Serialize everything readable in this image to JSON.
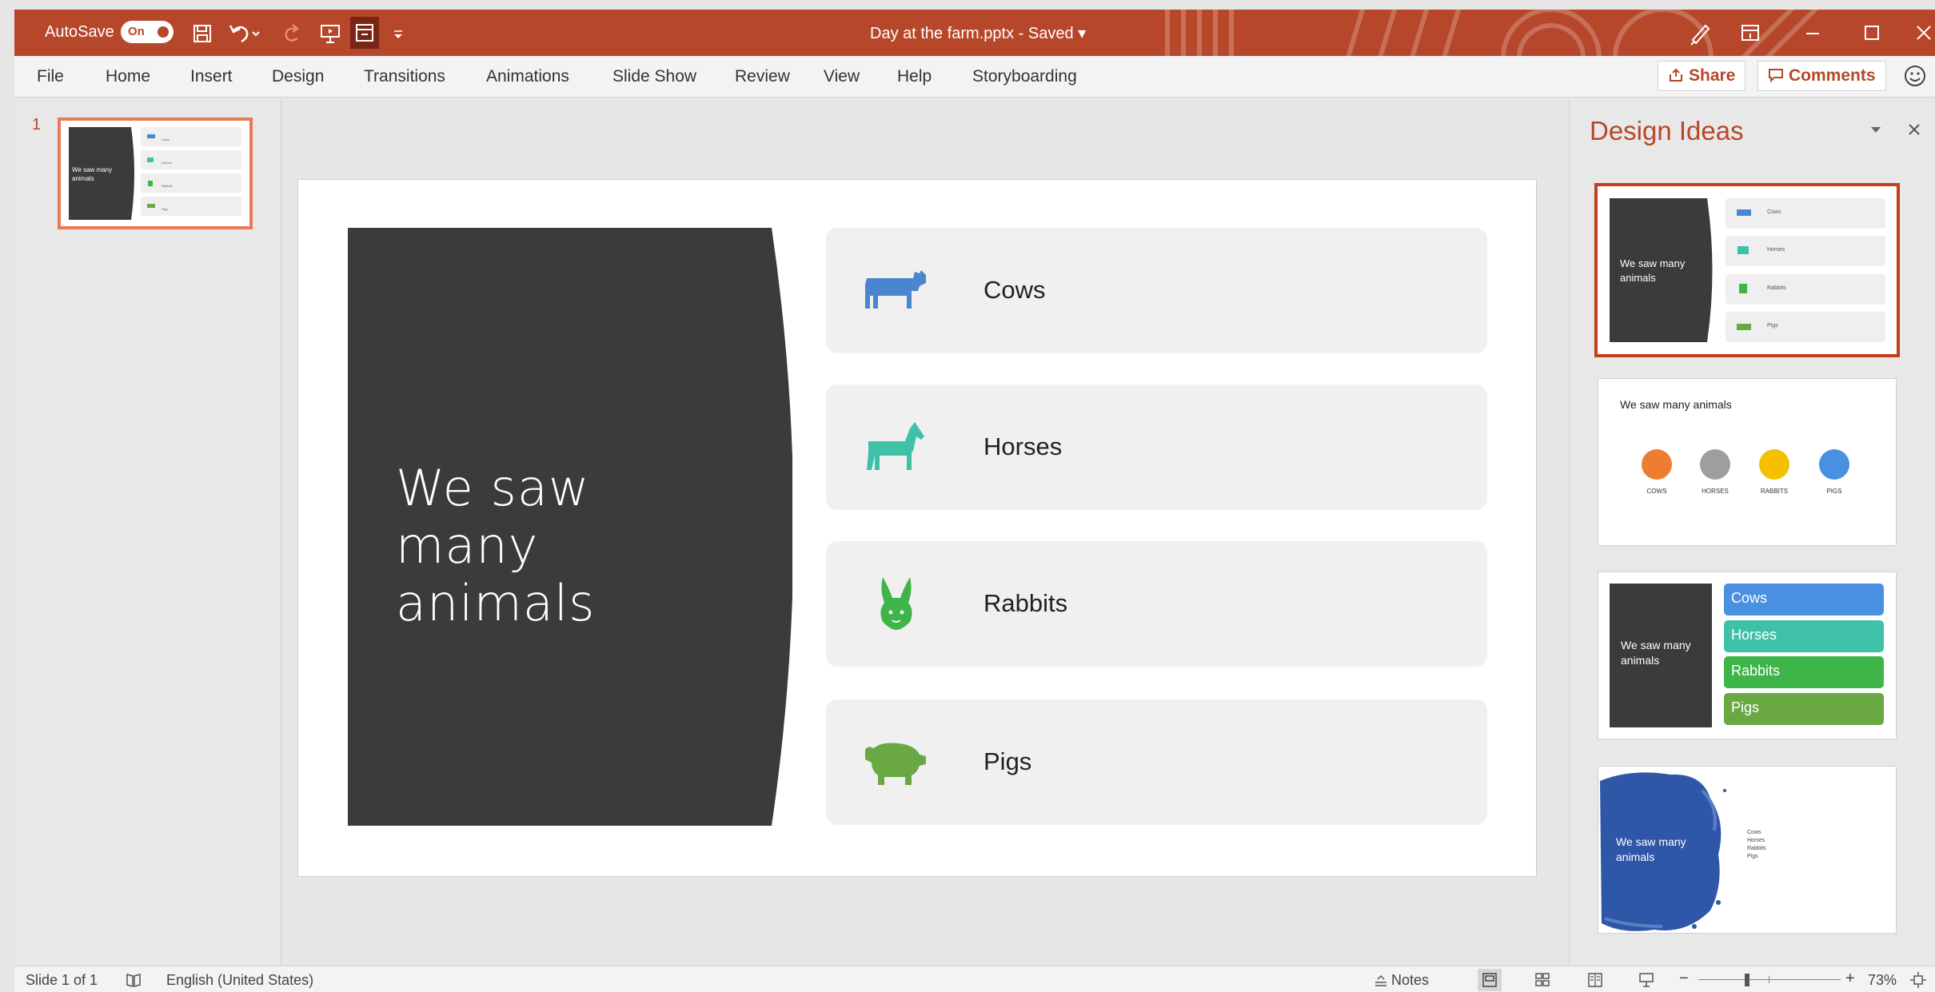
{
  "titlebar": {
    "autosave_label": "AutoSave",
    "autosave_state": "On",
    "doc_title": "Day at the farm.pptx  -  Saved  ▾",
    "accent": "#b7472a"
  },
  "tabs": [
    "File",
    "Home",
    "Insert",
    "Design",
    "Transitions",
    "Animations",
    "Slide Show",
    "Review",
    "View",
    "Help",
    "Storyboarding"
  ],
  "share_label": "Share",
  "comments_label": "Comments",
  "thumbnail": {
    "number": "1",
    "title": "We saw many animals",
    "items": [
      "Cows",
      "Horses",
      "Rabbits",
      "Pigs"
    ]
  },
  "slide": {
    "title": "We saw many animals",
    "items": [
      {
        "label": "Cows",
        "icon": "cow-icon",
        "color": "#4a86d0"
      },
      {
        "label": "Horses",
        "icon": "horse-icon",
        "color": "#3fc1a8"
      },
      {
        "label": "Rabbits",
        "icon": "rabbit-icon",
        "color": "#3db548"
      },
      {
        "label": "Pigs",
        "icon": "pig-icon",
        "color": "#6aa843"
      }
    ]
  },
  "design_ideas": {
    "title": "Design Ideas",
    "idea1": {
      "title": "We saw many animals",
      "items": [
        "Cows",
        "Horses",
        "Rabbits",
        "Pigs"
      ]
    },
    "idea2": {
      "title": "We saw many animals",
      "items": [
        "COWS",
        "HORSES",
        "RABBITS",
        "PIGS"
      ],
      "colors": [
        "#ed7d31",
        "#9e9e9e",
        "#f5c000",
        "#4a90e2"
      ]
    },
    "idea3": {
      "title": "We saw many animals",
      "items": [
        "Cows",
        "Horses",
        "Rabbits",
        "Pigs"
      ],
      "colors": [
        "#4a90e2",
        "#3fc1a8",
        "#3db548",
        "#6aa843"
      ]
    },
    "idea4": {
      "title": "We saw many animals",
      "items": [
        "Cows",
        "Horses",
        "Rabbits",
        "Pigs"
      ]
    }
  },
  "status": {
    "slide_count": "Slide 1 of 1",
    "language": "English (United States)",
    "notes": "Notes",
    "zoom": "73%"
  }
}
